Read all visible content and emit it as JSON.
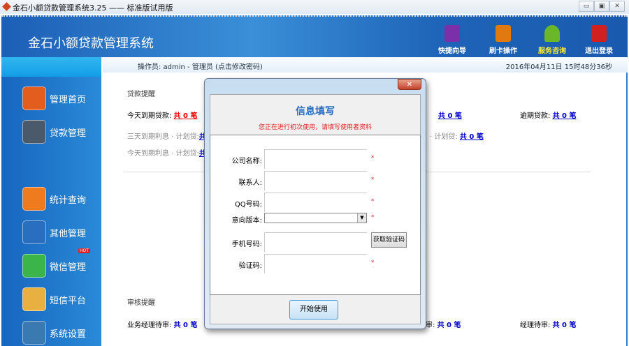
{
  "window": {
    "title": "金石小额贷款管理系统3.25 —— 标准版试用版",
    "controls": [
      "▭",
      "▣",
      "✕"
    ]
  },
  "header": {
    "app_title": "金石小额贷款管理系统",
    "buttons": [
      {
        "label": "快捷向导",
        "color": "#7b2fa8"
      },
      {
        "label": "刷卡操作",
        "color": "#e07a10"
      },
      {
        "label": "服务咨询",
        "color": "#6ab82a"
      },
      {
        "label": "退出登录",
        "color": "#d02020"
      }
    ]
  },
  "subbar": {
    "operator": "操作员: admin - 管理员  (点击修改密码)",
    "datetime": "2016年04月11日  15时48分36秒"
  },
  "sidebar": {
    "items": [
      {
        "label": "管理首页",
        "color": "#e35d1e"
      },
      {
        "label": "贷款管理",
        "color": "#4b5a6a"
      },
      {
        "label": "统计查询",
        "color": "#f07a1e"
      },
      {
        "label": "其他管理",
        "color": "#2a6ec0"
      },
      {
        "label": "微信管理",
        "color": "#3bb54a",
        "badge": "HOT"
      },
      {
        "label": "短信平台",
        "color": "#e8b040"
      },
      {
        "label": "系统设置",
        "color": "#3a7ab0"
      }
    ]
  },
  "main": {
    "loan_section": "贷款提醒",
    "today_due_label": "今天到期贷款:",
    "today_due": "共 0 笔",
    "mid_due": "共 0 笔",
    "overdue_label": "逾期贷款:",
    "overdue": "共 0 笔",
    "three_day_label": "三天到期利息 · 计划贷:",
    "three_day": "共",
    "three_day_right_label": "· 计划贷:",
    "three_day_right": "共 0 笔",
    "today_interest_label": "今天到期利息 · 计划贷:",
    "today_interest": "共",
    "review_section": "审核提醒",
    "biz_mgr_label": "业务经理待审:",
    "biz_mgr": "共 0 笔",
    "mid_review_label": "审:",
    "mid_review": "共 0 笔",
    "mgr_label": "经理待审:",
    "mgr": "共 0 笔"
  },
  "dialog": {
    "close": "✕",
    "title": "信息填写",
    "subtitle": "您正在进行初次使用，请填写使用者资料",
    "fields": [
      {
        "label": "公司名称:",
        "value": ""
      },
      {
        "label": "联系人:",
        "value": ""
      },
      {
        "label": "QQ号码:",
        "value": ""
      },
      {
        "label": "意向版本:",
        "value": ""
      },
      {
        "label": "手机号码:",
        "value": ""
      },
      {
        "label": "验证码:",
        "value": ""
      }
    ],
    "required_mark": "*",
    "get_code": "获取验证码",
    "start": "开始使用"
  }
}
